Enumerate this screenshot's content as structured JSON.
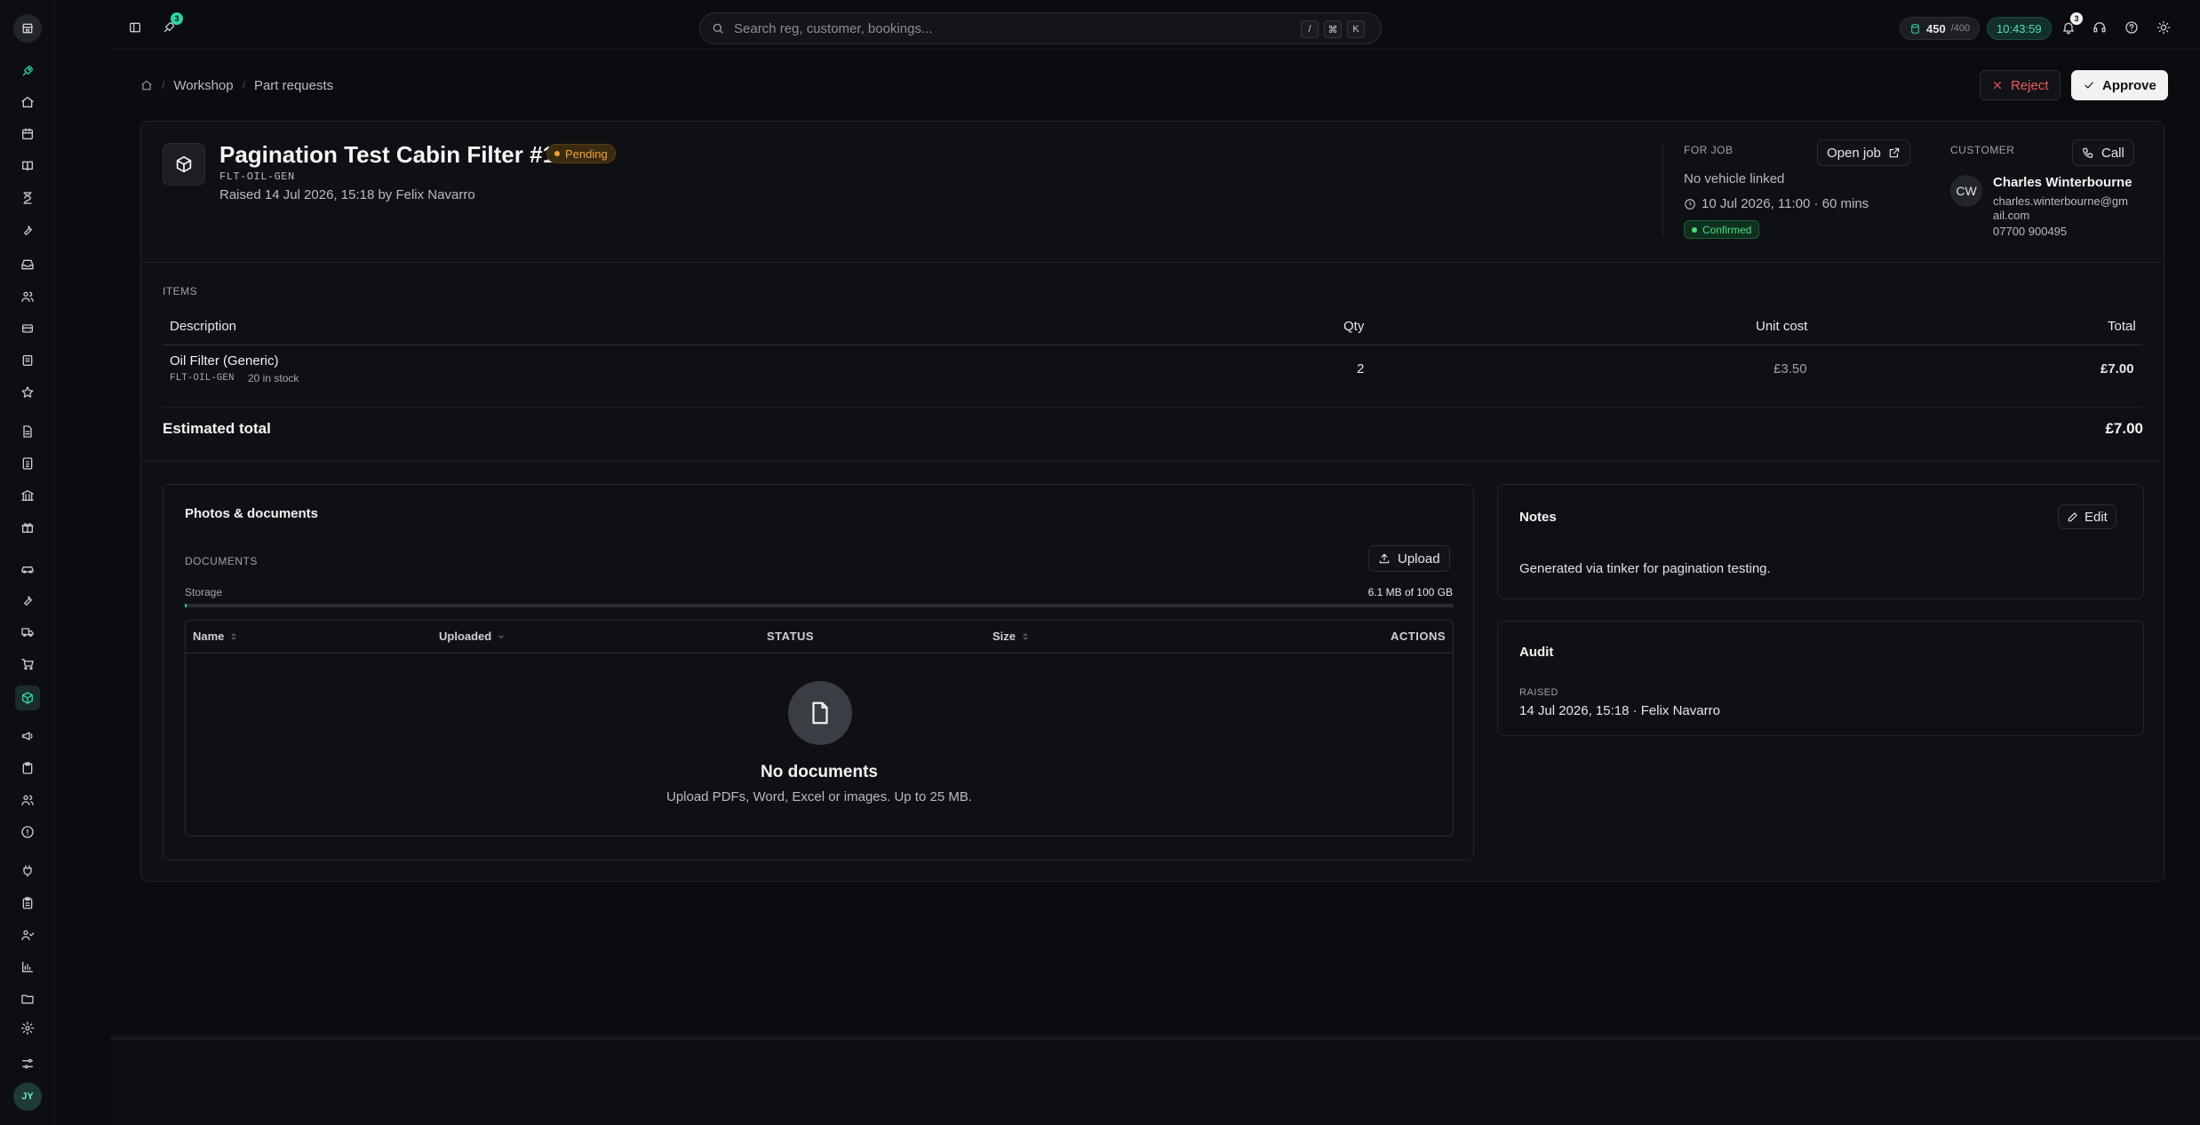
{
  "topbar": {
    "rocket_badge": "3",
    "search_placeholder": "Search reg, customer, bookings...",
    "kbd_keys": [
      "/",
      "⌘",
      "K"
    ],
    "credits_value": "450",
    "credits_max": "/400",
    "clock": "10:43:59",
    "notifications_count": "3"
  },
  "sidebar": {
    "avatar_initials": "JY"
  },
  "breadcrumb": {
    "items": [
      "Workshop",
      "Part requests"
    ]
  },
  "actions": {
    "reject_label": "Reject",
    "approve_label": "Approve"
  },
  "request": {
    "title": "Pagination Test Cabin Filter #142",
    "status": "Pending",
    "code": "FLT-OIL-GEN",
    "raised_line": "Raised 14 Jul 2026, 15:18 by Felix Navarro"
  },
  "job": {
    "label": "FOR JOB",
    "open_label": "Open job",
    "vehicle": "No vehicle linked",
    "datetime": "10 Jul 2026, 11:00 · 60 mins",
    "status": "Confirmed"
  },
  "customer": {
    "label": "CUSTOMER",
    "call_label": "Call",
    "initials": "CW",
    "name": "Charles Winterbourne",
    "email_line1": "charles.winterbourne@gm",
    "email_line2": "ail.com",
    "phone": "07700 900495"
  },
  "items": {
    "section_label": "ITEMS",
    "headers": {
      "description": "Description",
      "qty": "Qty",
      "unit_cost": "Unit cost",
      "total": "Total"
    },
    "rows": [
      {
        "name": "Oil Filter (Generic)",
        "sku": "FLT-OIL-GEN",
        "stock": "20 in stock",
        "qty": "2",
        "unit_cost": "£3.50",
        "total": "£7.00"
      }
    ],
    "estimated_label": "Estimated total",
    "estimated_value": "£7.00"
  },
  "documents": {
    "panel_title": "Photos & documents",
    "section_label": "DOCUMENTS",
    "upload_label": "Upload",
    "storage_label": "Storage",
    "storage_value": "6.1 MB of 100 GB",
    "storage_used_fraction": 6e-05,
    "headers": {
      "name": "Name",
      "uploaded": "Uploaded",
      "status": "STATUS",
      "size": "Size",
      "actions": "ACTIONS"
    },
    "empty_title": "No documents",
    "empty_text": "Upload PDFs, Word, Excel or images. Up to 25 MB."
  },
  "notes": {
    "title": "Notes",
    "edit_label": "Edit",
    "text": "Generated via tinker for pagination testing."
  },
  "audit": {
    "title": "Audit",
    "label": "RAISED",
    "value": "14 Jul 2026, 15:18 · Felix Navarro"
  },
  "colors": {
    "accent": "#2fd3a4",
    "pending": "#f0a13a",
    "confirmed": "#4ade80",
    "danger": "#ef5b5b"
  }
}
